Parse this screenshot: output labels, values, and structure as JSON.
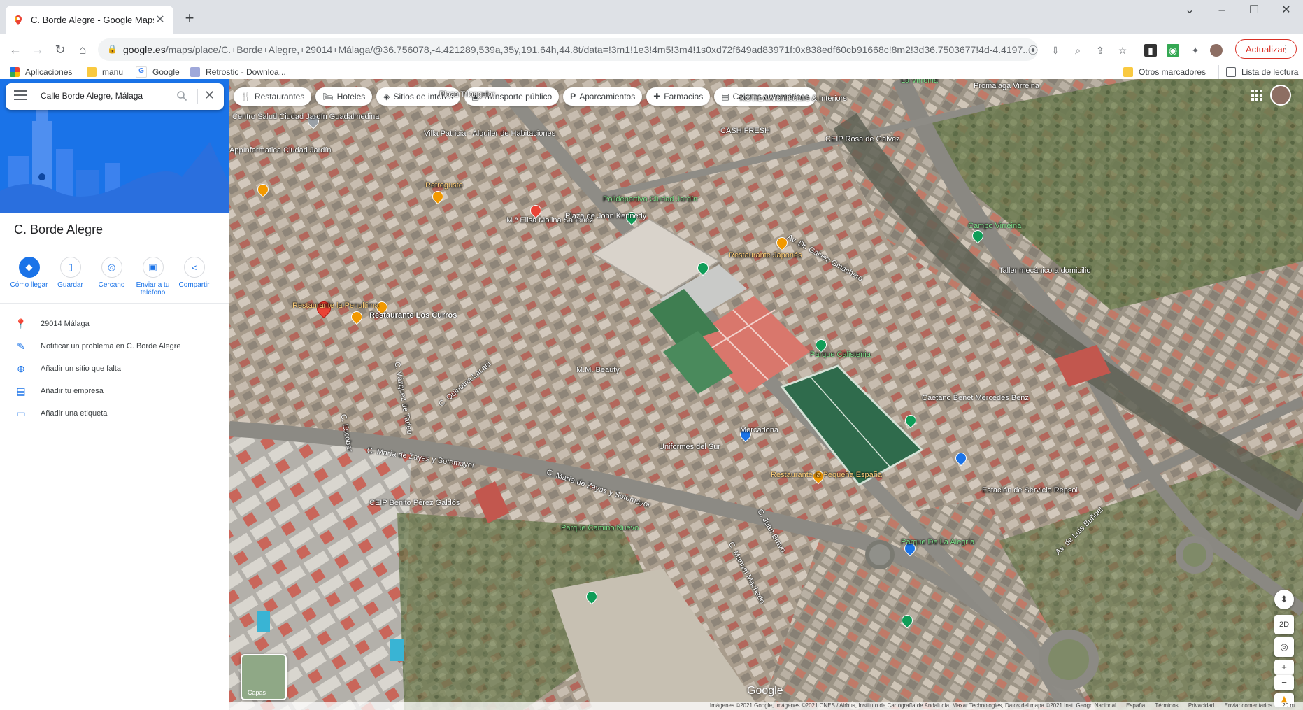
{
  "browser": {
    "tab_title": "C. Borde Alegre - Google Maps",
    "url_host": "google.es",
    "url_path": "/maps/place/C.+Borde+Alegre,+29014+Málaga/@36.756078,-4.421289,539a,35y,191.64h,44.8t/data=!3m1!1e3!4m5!3m4!1s0xd72f649ad83971f:0x838edf60cb91668c!8m2!3d36.7503677!4d-4.4197...",
    "update_label": "Actualizar",
    "bookmarks": {
      "apps": "Aplicaciones",
      "manu": "manu",
      "google": "Google",
      "retrostic": "Retrostic - Downloa...",
      "others": "Otros marcadores",
      "reading": "Lista de lectura"
    }
  },
  "sidebar": {
    "search_value": "Calle Borde Alegre, Málaga",
    "place_title": "C. Borde Alegre",
    "actions": [
      {
        "label": "Cómo llegar"
      },
      {
        "label": "Guardar"
      },
      {
        "label": "Cercano"
      },
      {
        "label": "Enviar a tu teléfono"
      },
      {
        "label": "Compartir"
      }
    ],
    "info": {
      "address": "29014 Málaga",
      "report": "Notificar un problema en C. Borde Alegre",
      "add_place": "Añadir un sitio que falta",
      "add_business": "Añadir tu empresa",
      "add_label": "Añadir una etiqueta"
    }
  },
  "map": {
    "chips": [
      {
        "label": "Restaurantes",
        "icon": "fork-knife-icon"
      },
      {
        "label": "Hoteles",
        "icon": "bed-icon"
      },
      {
        "label": "Sitios de interés",
        "icon": "camera-icon"
      },
      {
        "label": "Transporte público",
        "icon": "bus-icon"
      },
      {
        "label": "Aparcamientos",
        "icon": "parking-icon"
      },
      {
        "label": "Farmacias",
        "icon": "pharmacy-icon"
      },
      {
        "label": "Cajeros automáticos",
        "icon": "atm-icon"
      }
    ],
    "labels": {
      "plaza_triangular": "Plaza Triangular",
      "centro_salud": "Centro Salud Ciudad Jardín Guadalmedina",
      "appinformatica": "AppInformatica Ciudad Jardín",
      "villa_patricia": "Villa Patricia - Alquiler de Habitaciones",
      "retrogusto": "Retrogusto",
      "elisa": "M.ª Elisa Molina Sánchez",
      "plaza_kennedy": "Plaza de John Kennedy",
      "polideportivo": "Polideportivo Ciudad Jardín",
      "restaurante_japones": "Restaurante Japonés",
      "restaurante_penultima": "Restaurante la Penultima",
      "restaurante_curros": "Restaurante Los Curros",
      "cash_fresh": "CASH FRESH",
      "ceip_rosa": "CEIP Rosa de Gálvez",
      "campo_virreina": "Campo Virreina",
      "taller": "Taller mecánico a domicilio",
      "parque_calistenia": "Parque Calistenia",
      "mm_beauty": "M.M. Beauty",
      "caetano": "Caetano Benet Mercedes Benz",
      "mercadona": "Mercadona",
      "uniformes": "Uniformes del Sur",
      "restaurante_pequena": "Restaurante la Pequeña España",
      "estacion_repsol": "Estación de Servicio Repsol",
      "ceip_benito": "CEIP Benito Pérez Galdós",
      "parque_camino": "Parque Camino Nuevo",
      "parque_alegria": "Parque De La Alegría",
      "promalaga": "Promalaga Virreina",
      "kotila": "KOTILA Architecture & Interiors",
      "la_virreina": "La Virreina",
      "calle_maria": "C. María de Zayas y Sotomayor",
      "calle_maria2": "C. María de Zayas y Sotomayor",
      "calle_quintana": "C. Quintana Lacaci",
      "calle_vasquez": "C. Vázquez de Tadeo",
      "calle_escobar": "C. Escobar",
      "calle_juan_bravo": "C. Juan Bravo",
      "calle_manuel": "C. Manuel Machado",
      "av_dr": "Av. Dr. Gálvez Ginachero",
      "av_luis": "Av. de Luis Buñuel"
    },
    "layers_label": "Capas",
    "google_logo": "Google",
    "ctl_2d": "2D",
    "attribution": "Imágenes ©2021 Google, Imágenes ©2021 CNES / Airbus, Instituto de Cartografía de Andalucía, Maxar Technologies, Datos del mapa ©2021 Inst. Geogr. Nacional",
    "attr_country": "España",
    "attr_terms": "Términos",
    "attr_privacy": "Privacidad",
    "attr_feedback": "Enviar comentarios",
    "attr_scale": "20 m"
  },
  "colors": {
    "accent": "#1a73e8",
    "update_red": "#d93025"
  }
}
